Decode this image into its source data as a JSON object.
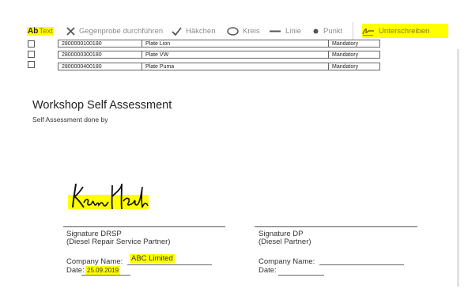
{
  "toolbar": {
    "text_tool": {
      "icon_label": "Ab",
      "label": "Text"
    },
    "cross_check": {
      "label": "Gegenprobe durchführen"
    },
    "checkmark": {
      "label": "Häkchen"
    },
    "circle": {
      "label": "Kreis"
    },
    "line": {
      "label": "Linie"
    },
    "dot": {
      "label": "Punkt"
    },
    "sign": {
      "label": "Unterschreiben"
    },
    "highlight_color": "#ffff00"
  },
  "table": {
    "rows": [
      {
        "number": "2800000100180",
        "name": "Plate Lion",
        "requirement": "Mandatory"
      },
      {
        "number": "2800000300180",
        "name": "Plate VW",
        "requirement": "Mandatory"
      },
      {
        "number": "2800000400180",
        "name": "Plate Puma",
        "requirement": "Mandatory"
      }
    ]
  },
  "document": {
    "title": "Workshop Self Assessment",
    "subtitle": "Self Assessment done by",
    "left": {
      "sig_title": "Signature DRSP",
      "sig_sub": "(Diesel Repair Service Partner)",
      "company_label": "Company Name:",
      "company_value": "ABC Limited",
      "date_label": "Date:",
      "date_value": "25.09.2019"
    },
    "right": {
      "sig_title": "Signature DP",
      "sig_sub": "(Diesel Partner)",
      "company_label": "Company Name:",
      "date_label": "Date:"
    }
  }
}
